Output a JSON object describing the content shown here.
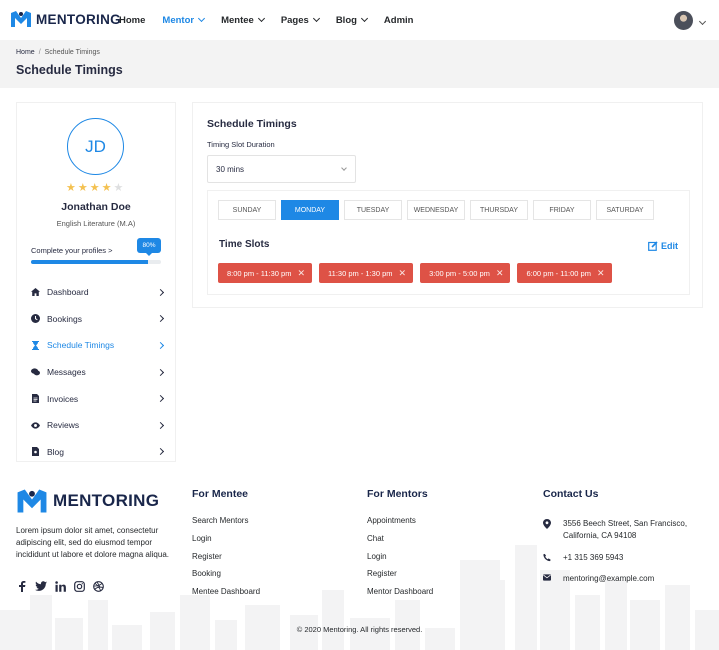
{
  "brand": {
    "name": "MENTORING"
  },
  "nav": [
    {
      "label": "Home",
      "active": false,
      "dropdown": false
    },
    {
      "label": "Mentor",
      "active": true,
      "dropdown": true
    },
    {
      "label": "Mentee",
      "active": false,
      "dropdown": true
    },
    {
      "label": "Pages",
      "active": false,
      "dropdown": true
    },
    {
      "label": "Blog",
      "active": false,
      "dropdown": true
    },
    {
      "label": "Admin",
      "active": false,
      "dropdown": false
    }
  ],
  "breadcrumb": {
    "home": "Home",
    "separator": "/",
    "current": "Schedule Timings"
  },
  "page_title": "Schedule Timings",
  "profile": {
    "initials": "JD",
    "name": "Jonathan Doe",
    "degree": "English Literature (M.A)",
    "rating": 4,
    "rating_max": 5,
    "complete_label": "Complete your profiles >",
    "complete_badge": "80%",
    "complete_fraction": 0.9
  },
  "menu": [
    {
      "label": "Dashboard",
      "icon": "home-icon",
      "active": false
    },
    {
      "label": "Bookings",
      "icon": "clock-icon",
      "active": false
    },
    {
      "label": "Schedule Timings",
      "icon": "hourglass-icon",
      "active": true
    },
    {
      "label": "Messages",
      "icon": "chat-icon",
      "active": false
    },
    {
      "label": "Invoices",
      "icon": "invoice-icon",
      "active": false
    },
    {
      "label": "Reviews",
      "icon": "eye-icon",
      "active": false
    },
    {
      "label": "Blog",
      "icon": "blog-icon",
      "active": false
    }
  ],
  "schedule": {
    "title": "Schedule Timings",
    "duration_label": "Timing Slot Duration",
    "duration_value": "30 mins",
    "days": [
      "SUNDAY",
      "MONDAY",
      "TUESDAY",
      "WEDNESDAY",
      "THURSDAY",
      "FRIDAY",
      "SATURDAY"
    ],
    "active_day": "MONDAY",
    "slots_title": "Time Slots",
    "edit_label": "Edit",
    "slots": [
      "8:00 pm - 11:30 pm",
      "11:30 pm - 1:30 pm",
      "3:00 pm - 5:00 pm",
      "6:00 pm - 11:00 pm"
    ]
  },
  "footer": {
    "about": "Lorem ipsum dolor sit amet, consectetur adipiscing elit, sed do eiusmod tempor incididunt ut labore et dolore magna aliqua.",
    "socials": [
      "facebook-icon",
      "twitter-icon",
      "linkedin-icon",
      "instagram-icon",
      "dribbble-icon"
    ],
    "mentee": {
      "title": "For Mentee",
      "links": [
        "Search Mentors",
        "Login",
        "Register",
        "Booking",
        "Mentee Dashboard"
      ]
    },
    "mentors": {
      "title": "For Mentors",
      "links": [
        "Appointments",
        "Chat",
        "Login",
        "Register",
        "Mentor Dashboard"
      ]
    },
    "contact": {
      "title": "Contact Us",
      "address_line1": "3556 Beech Street, San Francisco,",
      "address_line2": "California, CA 94108",
      "phone": "+1 315 369 5943",
      "email": "mentoring@example.com"
    },
    "copyright": "© 2020 Mentoring. All rights reserved."
  },
  "colors": {
    "primary": "#1e88e5",
    "slot": "#de5246",
    "dark": "#19264a",
    "star": "#f4c150"
  }
}
